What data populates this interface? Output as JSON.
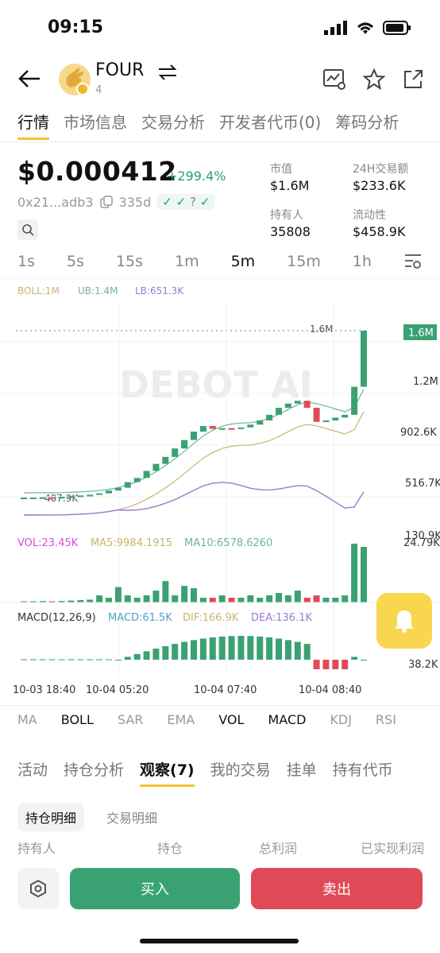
{
  "status": {
    "time": "09:15"
  },
  "header": {
    "name": "FOUR",
    "sub": "4"
  },
  "tabs": [
    "行情",
    "市场信息",
    "交易分析",
    "开发者代币(0)",
    "筹码分析"
  ],
  "price": {
    "value": "$0.000412",
    "change": "+299.4%"
  },
  "addr": {
    "short": "0x21...adb3",
    "age": "335d"
  },
  "stats": {
    "mcap_label": "市值",
    "mcap": "$1.6M",
    "vol_label": "24H交易额",
    "vol": "$233.6K",
    "holders_label": "持有人",
    "holders": "35808",
    "liq_label": "流动性",
    "liq": "$458.9K"
  },
  "timeframes": [
    "1s",
    "5s",
    "15s",
    "1m",
    "5m",
    "15m",
    "1h"
  ],
  "chart_header": {
    "boll": "BOLL:1M",
    "ub": "UB:1.4M",
    "lb": "LB:651.3K"
  },
  "vol_header": {
    "vol": "VOL:23.45K",
    "ma5": "MA5:9984.1915",
    "ma10": "MA10:6578.6260"
  },
  "macd_header": {
    "macd_title": "MACD(12,26,9)",
    "macd": "MACD:61.5K",
    "dif": "DIF:166.9K",
    "dea": "DEA:136.1K"
  },
  "price_axis": [
    "1.6M",
    "1.2M",
    "902.6K",
    "516.7K",
    "130.9K"
  ],
  "current_price_label": "1.6M",
  "marker_price": "1.6M",
  "low_marker": "407.9K",
  "vol_axis": "24.79K",
  "macd_axis": "38.2K",
  "macd_axis_top": "K",
  "x_ticks": [
    "10-03 18:40",
    "10-04 05:20",
    "10-04 07:40",
    "10-04 08:40"
  ],
  "watermark": "DEBOT AI",
  "indicators": [
    "MA",
    "BOLL",
    "SAR",
    "EMA",
    "VOL",
    "MACD",
    "KDJ",
    "RSI"
  ],
  "sub_tabs": [
    "活动",
    "持仓分析",
    "观察(7)",
    "我的交易",
    "挂单",
    "持有代币"
  ],
  "pills": {
    "active": "持仓明细",
    "other": "交易明细"
  },
  "columns": [
    "持有人",
    "持仓",
    "总利润",
    "已实现利润"
  ],
  "actions": {
    "buy": "买入",
    "sell": "卖出"
  },
  "colors": {
    "up": "#3aa272",
    "down": "#e04a57",
    "accent": "#f2c230"
  },
  "chart_data": {
    "type": "candlestick",
    "x_ticks": [
      "10-03 18:40",
      "10-04 05:20",
      "10-04 07:40",
      "10-04 08:40"
    ],
    "y_ticks": [
      "1.6M",
      "1.2M",
      "902.6K",
      "516.7K",
      "130.9K"
    ],
    "candles_close_k": [
      410,
      410,
      412,
      410,
      415,
      420,
      425,
      430,
      440,
      460,
      480,
      520,
      550,
      600,
      650,
      700,
      760,
      820,
      880,
      920,
      900,
      905,
      900,
      910,
      930,
      960,
      1000,
      1050,
      1080,
      1100,
      1050,
      950,
      960,
      980,
      1000,
      1200,
      1600
    ],
    "volume_k": [
      0.5,
      0.5,
      0.6,
      0.5,
      0.6,
      0.8,
      1,
      1.2,
      3,
      2,
      6.5,
      3,
      2,
      3,
      5,
      9,
      3,
      7,
      6,
      2,
      2,
      3,
      2,
      2,
      3,
      2,
      3,
      4,
      3,
      5,
      2,
      3,
      2,
      2,
      3,
      24.79,
      23.45
    ]
  }
}
